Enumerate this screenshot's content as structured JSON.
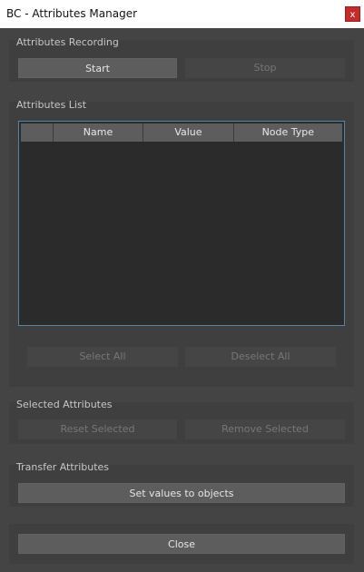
{
  "window": {
    "title": "BC - Attributes Manager",
    "close_glyph": "x"
  },
  "recording": {
    "label": "Attributes Recording",
    "start": "Start",
    "stop": "Stop"
  },
  "list": {
    "label": "Attributes List",
    "columns": [
      "",
      "Name",
      "Value",
      "Node Type"
    ],
    "select_all": "Select All",
    "deselect_all": "Deselect All"
  },
  "selected": {
    "label": "Selected Attributes",
    "reset": "Reset Selected",
    "remove": "Remove Selected"
  },
  "transfer": {
    "label": "Transfer Attributes",
    "set_values": "Set values to objects"
  },
  "footer": {
    "close": "Close"
  }
}
